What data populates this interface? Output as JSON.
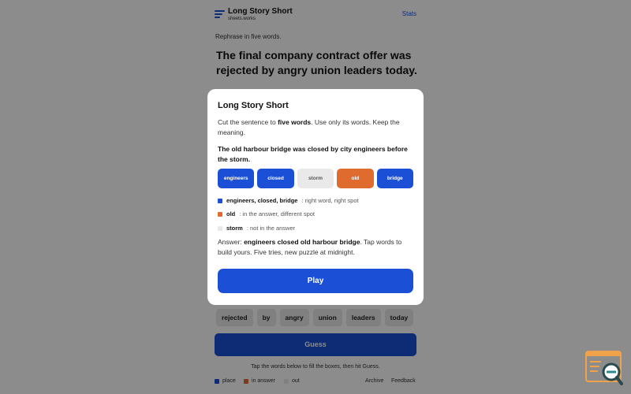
{
  "header": {
    "title": "Long Story Short",
    "subtitle": "sheets.works",
    "stats_link": "Stats"
  },
  "game": {
    "prompt": "Rephrase in five words.",
    "sentence": "The final company contract offer was rejected by angry union leaders today.",
    "tiles": [
      "rejected",
      "by",
      "angry",
      "union",
      "leaders",
      "today"
    ],
    "guess_label": "Guess",
    "hint": "Tap the words below to fill the boxes, then hit Guess."
  },
  "footer": {
    "legend": [
      {
        "label": "place",
        "color": "#1a4fd6"
      },
      {
        "label": "in answer",
        "color": "#e06b2f"
      },
      {
        "label": "out",
        "color": "#e9e9e9"
      }
    ],
    "archive_link": "Archive",
    "feedback_link": "Feedback"
  },
  "modal": {
    "title": "Long Story Short",
    "instructions": {
      "before": "Cut the sentence to ",
      "strong": "five words",
      "after": ". Use only its words. Keep the meaning."
    },
    "example_sentence": "The old harbour bridge was closed by city engineers before the storm.",
    "example_tiles": [
      {
        "word": "engineers",
        "state": "place",
        "color": "#1a4fd6",
        "text_color": "#ffffff"
      },
      {
        "word": "closed",
        "state": "place",
        "color": "#1a4fd6",
        "text_color": "#ffffff"
      },
      {
        "word": "storm",
        "state": "out",
        "color": "#e9e9e9",
        "text_color": "#555555"
      },
      {
        "word": "old",
        "state": "in answer",
        "color": "#e06b2f",
        "text_color": "#ffffff"
      },
      {
        "word": "bridge",
        "state": "place",
        "color": "#1a4fd6",
        "text_color": "#ffffff"
      }
    ],
    "key": [
      {
        "words": "engineers, closed, bridge",
        "desc": ": right word, right spot",
        "color": "#1a4fd6"
      },
      {
        "words": "old",
        "desc": ": in the answer, different spot",
        "color": "#e06b2f"
      },
      {
        "words": "storm",
        "desc": ": not in the answer",
        "color": "#e9e9e9"
      }
    ],
    "answer": {
      "prefix": "Answer: ",
      "strong": "engineers closed old harbour bridge",
      "suffix": ". Tap words to build yours. Five tries, new puzzle at midnight."
    },
    "play_label": "Play"
  },
  "colors": {
    "accent": "#1a4fd6",
    "present": "#e06b2f",
    "absent": "#e9e9e9"
  },
  "corner_icon": "search-document-icon"
}
